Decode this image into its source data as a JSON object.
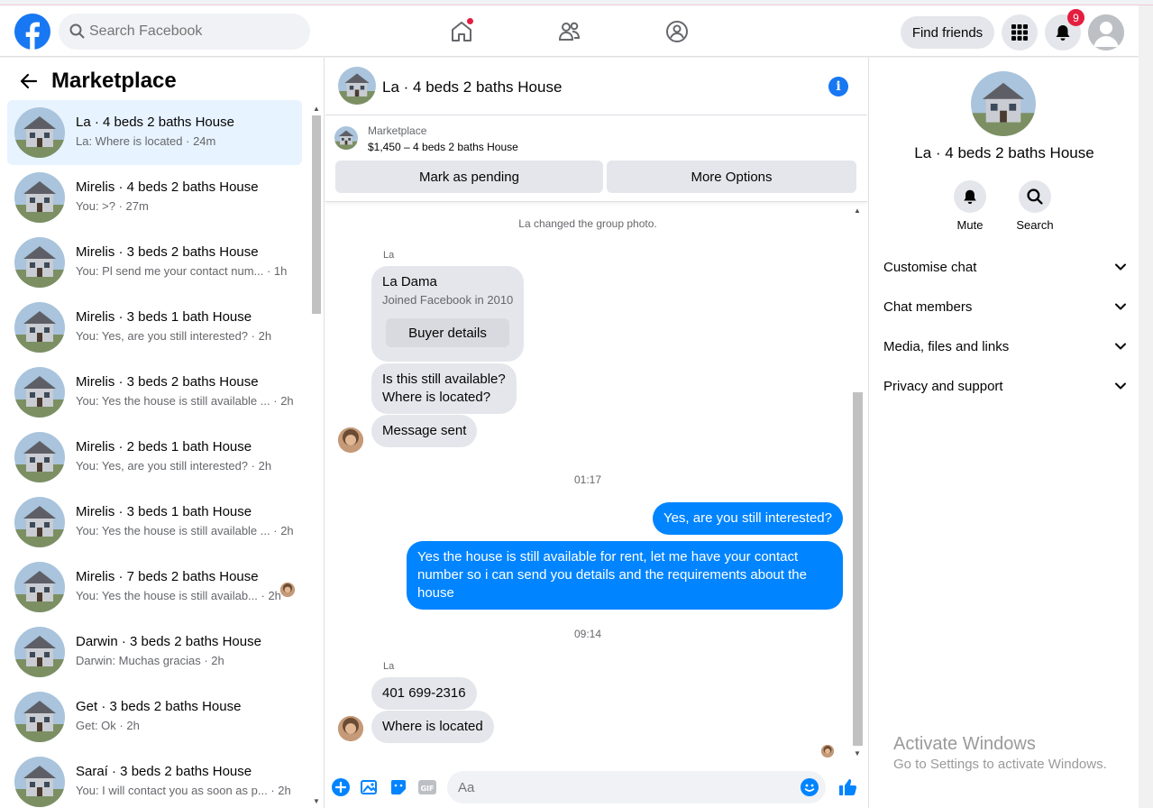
{
  "header": {
    "search_placeholder": "Search Facebook",
    "find_friends_label": "Find friends",
    "notification_count": "9",
    "brand_color": "#1877f2"
  },
  "sidebar": {
    "title": "Marketplace",
    "conversations": [
      {
        "title": "La · 4 beds 2 baths House",
        "preview": "La: Where is located",
        "time": "24m",
        "active": true
      },
      {
        "title": "Mirelis · 4 beds 2 baths House",
        "preview": "You: >?",
        "time": "27m"
      },
      {
        "title": "Mirelis · 3 beds 2 baths House",
        "preview": "You: Pl send me your contact num...",
        "time": "1h"
      },
      {
        "title": "Mirelis · 3 beds 1 bath House",
        "preview": "You: Yes, are you still interested?",
        "time": "2h"
      },
      {
        "title": "Mirelis · 3 beds 2 baths House",
        "preview": "You: Yes the house is still available ...",
        "time": "2h"
      },
      {
        "title": "Mirelis · 2 beds 1 bath House",
        "preview": "You: Yes, are you still interested?",
        "time": "2h"
      },
      {
        "title": "Mirelis · 3 beds 1 bath House",
        "preview": "You: Yes the house is still available ...",
        "time": "2h"
      },
      {
        "title": "Mirelis · 7 beds 2 baths House",
        "preview": "You: Yes the house is still availab...",
        "time": "2h"
      },
      {
        "title": "Darwin · 3 beds 2 baths House",
        "preview": "Darwin: Muchas gracias",
        "time": "2h"
      },
      {
        "title": "Get · 3 beds 2 baths House",
        "preview": "Get: Ok",
        "time": "2h"
      },
      {
        "title": "Saraí · 3 beds 2 baths House",
        "preview": "You: I will contact you as soon as p...",
        "time": "2h"
      }
    ]
  },
  "chat": {
    "title": "La · 4 beds 2 baths House",
    "marketplace_label": "Marketplace",
    "listing_price": "$1,450 – 4 beds 2 baths House",
    "mark_pending_label": "Mark as pending",
    "more_options_label": "More Options",
    "system_message": "La changed the group photo.",
    "sender_name": "La",
    "buyer_name": "La Dama",
    "buyer_joined": "Joined Facebook in 2010",
    "buyer_details_label": "Buyer details",
    "msg_available_1": "Is this still available?",
    "msg_available_2": "Where is located?",
    "msg_sent": "Message sent",
    "time_1": "01:17",
    "my_msg_1": "Yes, are you still interested?",
    "my_msg_2": "Yes the house is still available for rent, let me have your contact number so i can send you details and the requirements about the house",
    "time_2": "09:14",
    "msg_phone": "401 699-2316",
    "msg_where": "Where is located",
    "composer_placeholder": "Aa",
    "outgoing_color": "#0084ff"
  },
  "right_panel": {
    "title": "La · 4 beds 2 baths House",
    "mute_label": "Mute",
    "search_label": "Search",
    "sections": [
      "Customise chat",
      "Chat members",
      "Media, files and links",
      "Privacy and support"
    ]
  },
  "watermark": {
    "line1": "Activate Windows",
    "line2": "Go to Settings to activate Windows."
  }
}
